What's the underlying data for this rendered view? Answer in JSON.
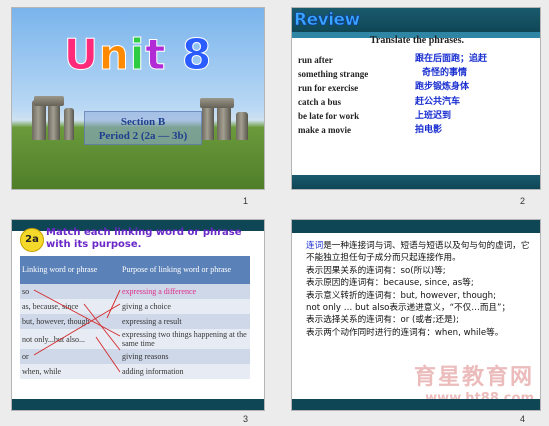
{
  "slide1": {
    "title_letters": [
      {
        "ch": "U",
        "color": "#ff2a7a"
      },
      {
        "ch": "n",
        "color": "#ff8a00"
      },
      {
        "ch": "i",
        "color": "#2ecc40"
      },
      {
        "ch": "t",
        "color": "#b12ad6"
      },
      {
        "ch": " ",
        "color": "#ffffff"
      },
      {
        "ch": "8",
        "color": "#2a5cff"
      }
    ],
    "section": "Section B",
    "period": "Period 2 (2a — 3b)",
    "number": "1"
  },
  "slide2": {
    "review_label": "Review",
    "heading": "Translate the phrases.",
    "phrases": [
      {
        "en": "run after",
        "zh": "跟在后面跑；追赶"
      },
      {
        "en": "something strange",
        "zh": "奇怪的事情"
      },
      {
        "en": "run for exercise",
        "zh": "跑步锻炼身体"
      },
      {
        "en": "catch a bus",
        "zh": "赶公共汽车"
      },
      {
        "en": "be late for work",
        "zh": "上班迟到"
      },
      {
        "en": "make a movie",
        "zh": "拍电影"
      }
    ],
    "number": "2"
  },
  "slide3": {
    "badge": "2a",
    "title": "Match each linking word or phrase with its purpose.",
    "col1_header": "Linking word or phrase",
    "col2_header": "Purpose of linking word or phrase",
    "rows": [
      {
        "word": "so",
        "purpose": "expressing a difference",
        "highlight": true
      },
      {
        "word": "as, because, since",
        "purpose": "giving a choice",
        "highlight": false
      },
      {
        "word": "but, however, though",
        "purpose": "expressing a result",
        "highlight": false
      },
      {
        "word": "not only...but also...",
        "purpose": "expressing two things happening at the same time",
        "highlight": false
      },
      {
        "word": "or",
        "purpose": "giving reasons",
        "highlight": false
      },
      {
        "word": "when, while",
        "purpose": "adding information",
        "highlight": false
      }
    ],
    "number": "3"
  },
  "slide4": {
    "term": "连词",
    "lines": [
      "是一种连接词与词、短语与短语以及句与句的虚词，它不能独立担任句子成分而只起连接作用。",
      "表示因果关系的连词有：so(所以)等;",
      "表示原因的连词有：because, since, as等;",
      "表示意义转折的连词有：but, however, though;",
      "not only … but also表示递进意义，“不仅…而且”；",
      "表示选择关系的连词有：or (或者;还是);",
      "表示两个动作同时进行的连词有：when, while等。"
    ],
    "watermark": "育星教育网",
    "watermark_url": "www.ht88.com",
    "number": "4"
  }
}
